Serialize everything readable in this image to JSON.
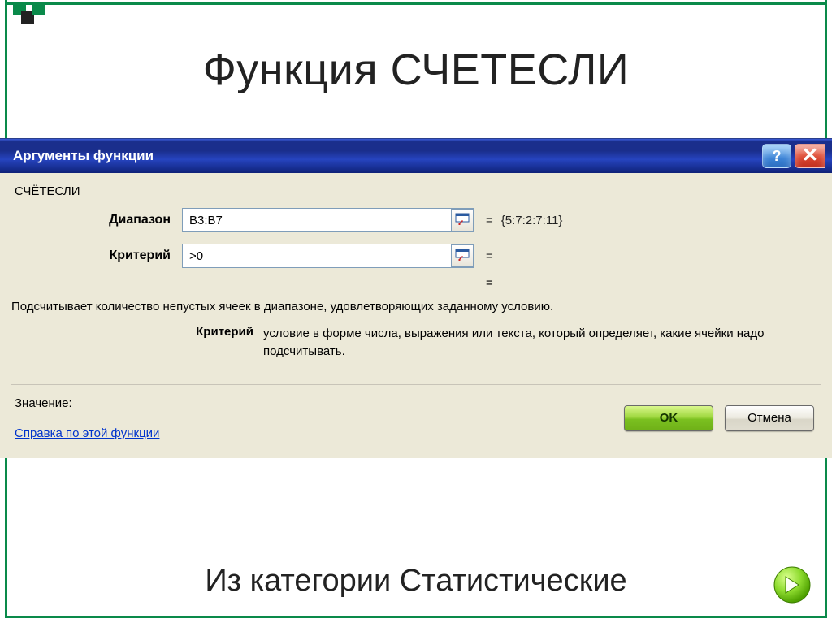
{
  "slide": {
    "title": "Функция СЧЕТЕСЛИ",
    "caption": "Из категории Статистические"
  },
  "dialog": {
    "title": "Аргументы функции",
    "function_name": "СЧЁТЕСЛИ",
    "args": {
      "range": {
        "label": "Диапазон",
        "value": "B3:B7",
        "result": "{5:7:2:7:11}"
      },
      "criteria": {
        "label": "Критерий",
        "value": ">0",
        "result": ""
      }
    },
    "equals": "=",
    "description": "Подсчитывает количество непустых ячеек в диапазоне, удовлетворяющих заданному условию.",
    "param_help": {
      "name": "Критерий",
      "text": "условие в форме числа, выражения или текста, который определяет, какие ячейки надо подсчитывать."
    },
    "value_label": "Значение:",
    "help_link": "Справка по этой функции",
    "ok": "OK",
    "cancel": "Отмена"
  },
  "icons": {
    "help": "?",
    "close": "close-icon",
    "ref": "range-picker-icon",
    "next": "arrow-right-icon"
  }
}
